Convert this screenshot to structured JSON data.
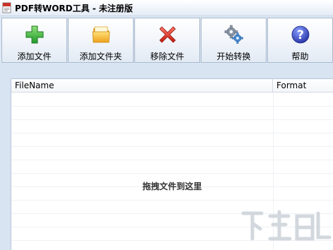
{
  "window": {
    "title": "PDF转WORD工具 - 未注册版",
    "icon": "pdf-app-icon"
  },
  "toolbar": {
    "buttons": [
      {
        "label": "添加文件",
        "icon": "green-plus-icon"
      },
      {
        "label": "添加文件夹",
        "icon": "folder-icon"
      },
      {
        "label": "移除文件",
        "icon": "red-x-icon"
      },
      {
        "label": "开始转换",
        "icon": "gears-icon"
      },
      {
        "label": "帮助",
        "icon": "help-question-icon"
      }
    ]
  },
  "file_list": {
    "columns": [
      "FileName",
      "Format"
    ],
    "rows": [],
    "empty_hint": "拖拽文件到这里"
  },
  "colors": {
    "background": "#d8e4f2",
    "add_icon": "#3cb83c",
    "folder_icon": "#f5b630",
    "remove_icon": "#d42a1e",
    "help_icon": "#3b4fc6"
  }
}
